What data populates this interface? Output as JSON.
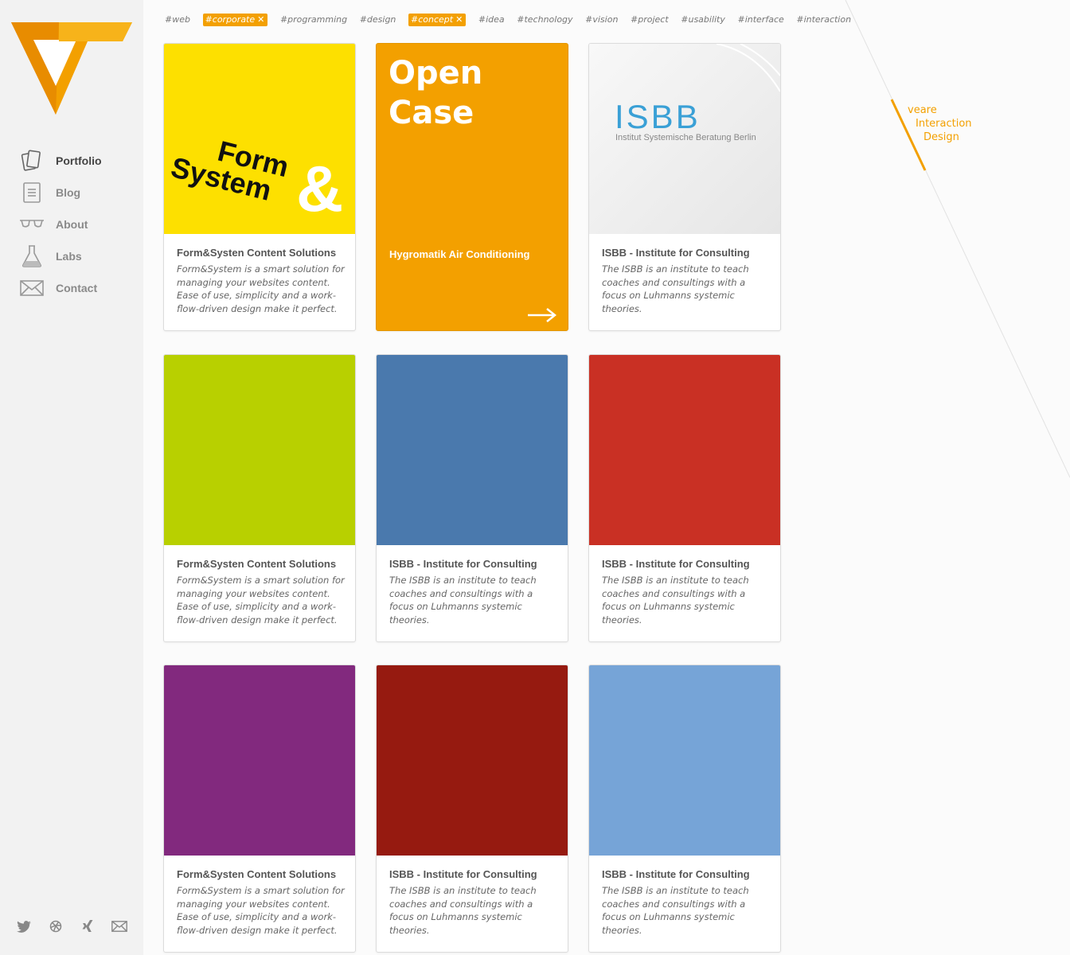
{
  "brand": {
    "line1": "veare",
    "line2": "Interaction",
    "line3": "Design",
    "accent": "#f3a000"
  },
  "nav": [
    {
      "label": "Portfolio",
      "icon": "portfolio-cards-icon",
      "active": true
    },
    {
      "label": "Blog",
      "icon": "document-icon"
    },
    {
      "label": "About",
      "icon": "glasses-icon"
    },
    {
      "label": "Labs",
      "icon": "flask-icon"
    },
    {
      "label": "Contact",
      "icon": "envelope-icon"
    }
  ],
  "social": [
    "twitter-icon",
    "dribbble-icon",
    "xing-icon",
    "mail-icon"
  ],
  "tags": [
    {
      "label": "#web"
    },
    {
      "label": "#corporate",
      "selected": true
    },
    {
      "label": "#programming"
    },
    {
      "label": "#design"
    },
    {
      "label": "#concept",
      "selected": true
    },
    {
      "label": "#idea"
    },
    {
      "label": "#technology"
    },
    {
      "label": "#vision"
    },
    {
      "label": "#project"
    },
    {
      "label": "#usability"
    },
    {
      "label": "#interface"
    },
    {
      "label": "#interaction"
    }
  ],
  "cards": [
    {
      "title": "Form&Systen Content Solutions",
      "desc": "Form&System is a smart solution for managing your websites content. Ease of use, simplicity and a work-flow-driven design make it perfect.",
      "color": "#fde000",
      "thumb_text_1": "Form",
      "thumb_text_2": "System",
      "thumb_text_3": "&"
    },
    {
      "big_title_1": "Open",
      "big_title_2": "Case",
      "subtitle": "Hygromatik Air Conditioning",
      "color": "#f3a000"
    },
    {
      "title": "ISBB - Institute for Consulting",
      "desc": "The ISBB is an institute to teach coaches and consultings with a focus on Luhmanns systemic theories.",
      "logo": "ISBB",
      "logo_sub": "Institut Systemische Beratung Berlin"
    },
    {
      "title": "Form&Systen Content Solutions",
      "desc": "Form&System is a smart solution for managing your websites content. Ease of use, simplicity and a work-flow-driven design make it perfect.",
      "color": "#b8d000"
    },
    {
      "title": "ISBB - Institute for Consulting",
      "desc": "The ISBB is an institute to teach coaches and consultings with a focus on Luhmanns systemic theories.",
      "color": "#4a79ad"
    },
    {
      "title": "ISBB - Institute for Consulting",
      "desc": "The ISBB is an institute to teach coaches and consultings with a focus on Luhmanns systemic theories.",
      "color": "#c93024"
    },
    {
      "title": "Form&Systen Content Solutions",
      "desc": "Form&System is a smart solution for managing your websites content. Ease of use, simplicity and a work-flow-driven design make it perfect.",
      "color": "#82297e"
    },
    {
      "title": "ISBB - Institute for Consulting",
      "desc": "The ISBB is an institute to teach coaches and consultings with a focus on Luhmanns systemic theories.",
      "color": "#961a10"
    },
    {
      "title": "ISBB - Institute for Consulting",
      "desc": "The ISBB is an institute to teach coaches and consultings with a focus on Luhmanns systemic theories.",
      "color": "#76a4d7"
    }
  ]
}
